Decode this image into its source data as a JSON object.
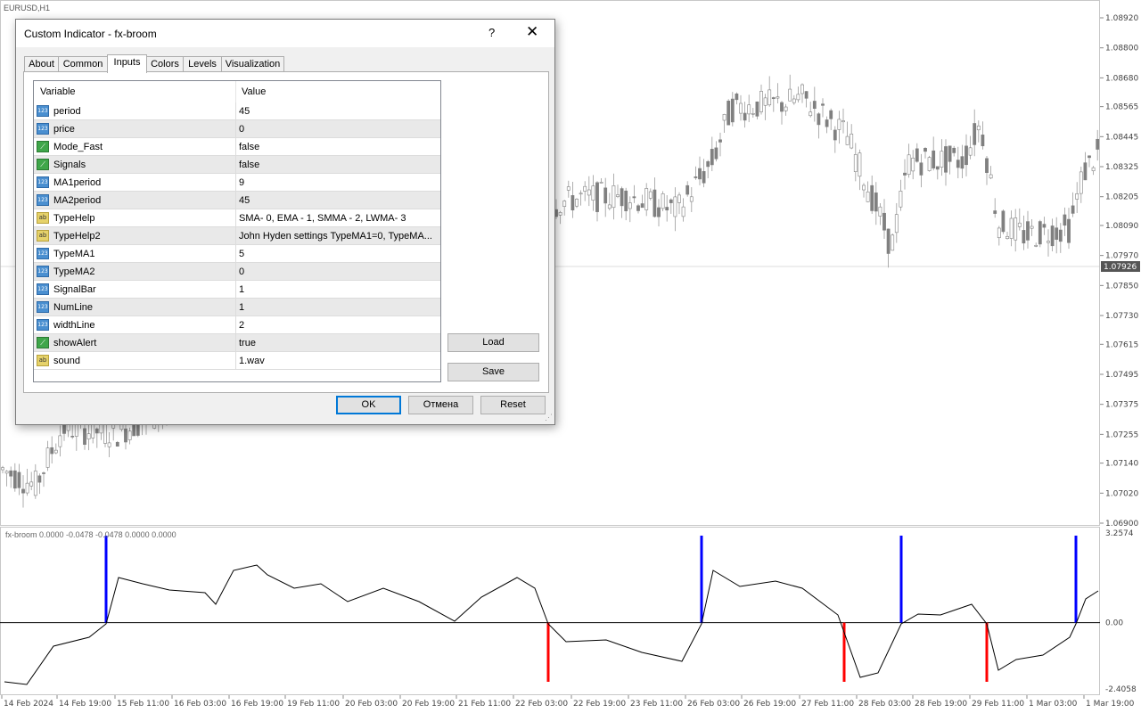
{
  "chart": {
    "symbol": "EURUSD,H1",
    "price_axis": [
      "1.08920",
      "1.08800",
      "1.08680",
      "1.08565",
      "1.08445",
      "1.08325",
      "1.08205",
      "1.08090",
      "1.07970",
      "1.07850",
      "1.07730",
      "1.07615",
      "1.07495",
      "1.07375",
      "1.07255",
      "1.07140",
      "1.07020",
      "1.06900"
    ],
    "current_price": "1.07926",
    "indicator_label": "fx-broom 0.0000 -0.0478 -0.0478 0.0000 0.0000",
    "indicator_axis": [
      "3.2574",
      "0.00",
      "-2.4058"
    ],
    "time_axis": [
      "14 Feb 2024",
      "14 Feb 19:00",
      "15 Feb 11:00",
      "16 Feb 03:00",
      "16 Feb 19:00",
      "19 Feb 11:00",
      "20 Feb 03:00",
      "20 Feb 19:00",
      "21 Feb 11:00",
      "22 Feb 03:00",
      "22 Feb 19:00",
      "23 Feb 11:00",
      "26 Feb 03:00",
      "26 Feb 19:00",
      "27 Feb 11:00",
      "28 Feb 03:00",
      "28 Feb 19:00",
      "29 Feb 11:00",
      "1 Mar 03:00",
      "1 Mar 19:00"
    ],
    "colors": {
      "buy_signal": "#0000ff",
      "sell_signal": "#ff0000",
      "candle": "#808080",
      "line": "#000000"
    }
  },
  "dialog": {
    "title": "Custom Indicator - fx-broom",
    "help": "?",
    "close": "✕",
    "tabs": [
      "About",
      "Common",
      "Inputs",
      "Colors",
      "Levels",
      "Visualization"
    ],
    "active_tab": "Inputs",
    "columns": {
      "variable": "Variable",
      "value": "Value"
    },
    "params": [
      {
        "icon": "num",
        "icon_text": "123",
        "name": "period",
        "value": "45"
      },
      {
        "icon": "num",
        "icon_text": "123",
        "name": "price",
        "value": "0"
      },
      {
        "icon": "bool",
        "icon_text": "⟋",
        "name": "Mode_Fast",
        "value": "false"
      },
      {
        "icon": "bool",
        "icon_text": "⟋",
        "name": "Signals",
        "value": "false"
      },
      {
        "icon": "num",
        "icon_text": "123",
        "name": "MA1period",
        "value": "9"
      },
      {
        "icon": "num",
        "icon_text": "123",
        "name": "MA2period",
        "value": "45"
      },
      {
        "icon": "str",
        "icon_text": "ab",
        "name": "TypeHelp",
        "value": "SMA- 0, EMA - 1, SMMA - 2, LWMA- 3"
      },
      {
        "icon": "str",
        "icon_text": "ab",
        "name": "TypeHelp2",
        "value": "John Hyden settings TypeMA1=0, TypeMA..."
      },
      {
        "icon": "num",
        "icon_text": "123",
        "name": "TypeMA1",
        "value": "5"
      },
      {
        "icon": "num",
        "icon_text": "123",
        "name": "TypeMA2",
        "value": "0"
      },
      {
        "icon": "num",
        "icon_text": "123",
        "name": "SignalBar",
        "value": "1"
      },
      {
        "icon": "num",
        "icon_text": "123",
        "name": "NumLine",
        "value": "1"
      },
      {
        "icon": "num",
        "icon_text": "123",
        "name": "widthLine",
        "value": "2"
      },
      {
        "icon": "bool",
        "icon_text": "⟋",
        "name": "showAlert",
        "value": "true"
      },
      {
        "icon": "str",
        "icon_text": "ab",
        "name": "sound",
        "value": " 1.wav"
      }
    ],
    "buttons": {
      "load": "Load",
      "save": "Save",
      "ok": "OK",
      "cancel": "Отмена",
      "reset": "Reset"
    }
  }
}
